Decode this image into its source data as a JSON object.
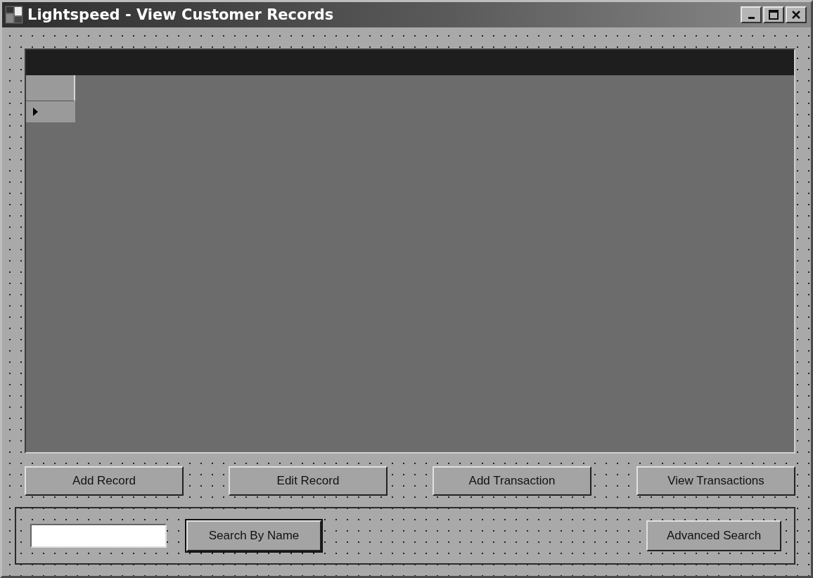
{
  "window": {
    "title": "Lightspeed - View Customer Records"
  },
  "record_buttons": [
    {
      "label": "Add Record"
    },
    {
      "label": "Edit Record"
    },
    {
      "label": "Add Transaction"
    },
    {
      "label": "View Transactions"
    }
  ],
  "search_panel": {
    "buttons": [
      {
        "label": "Search By Name",
        "default": true
      },
      {
        "label": "Advanced Search",
        "default": false
      }
    ]
  }
}
